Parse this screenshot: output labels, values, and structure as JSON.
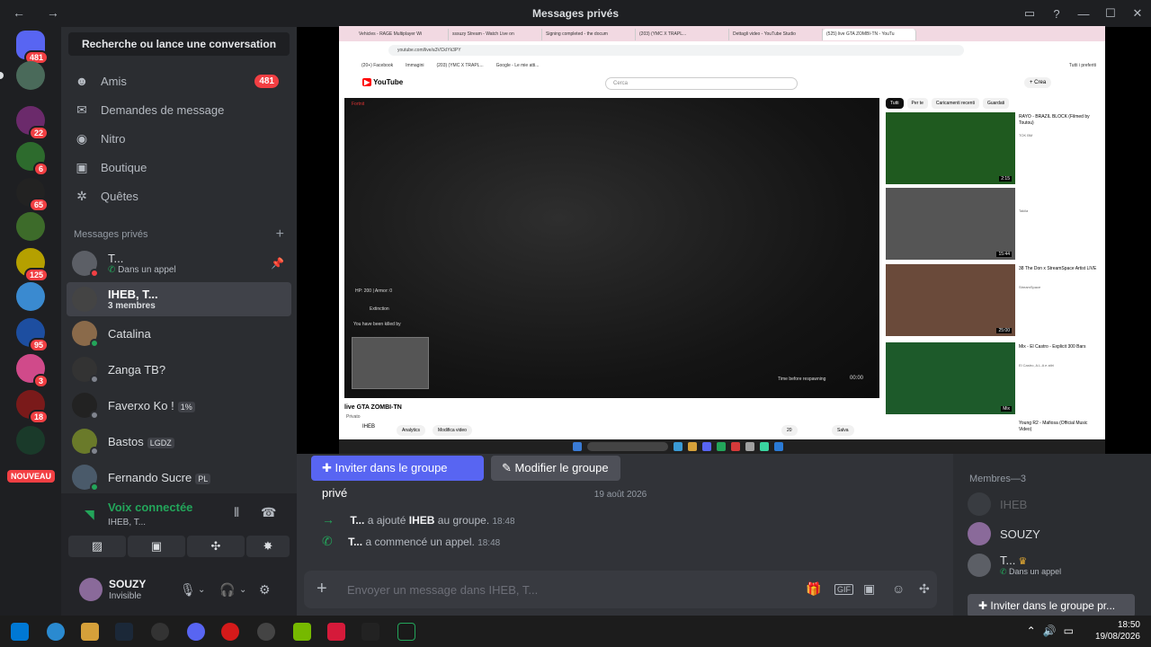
{
  "window": {
    "title": "Messages privés",
    "nav": "← →"
  },
  "guilds": {
    "badges": [
      "481",
      "",
      "22",
      "6",
      "65",
      "",
      "125",
      "",
      "95",
      "3",
      "18",
      ""
    ],
    "new_label": "NOUVEAU"
  },
  "sidebar": {
    "search_label": "Recherche ou lance une conversation",
    "nav": [
      {
        "label": "Amis",
        "icon": "friends-icon",
        "count": "481"
      },
      {
        "label": "Demandes de message",
        "icon": "mail-icon",
        "count": ""
      },
      {
        "label": "Nitro",
        "icon": "nitro-icon",
        "count": ""
      },
      {
        "label": "Boutique",
        "icon": "shop-icon",
        "count": ""
      },
      {
        "label": "Quêtes",
        "icon": "quests-icon",
        "count": ""
      }
    ],
    "dm_header": "Messages privés",
    "dms": [
      {
        "name": "T...",
        "sub": "Dans un appel",
        "tag": ""
      },
      {
        "name": "IHEB, T...",
        "sub": "3 membres",
        "tag": ""
      },
      {
        "name": "Catalina",
        "sub": "",
        "tag": ""
      },
      {
        "name": "Zanga TB?",
        "sub": "",
        "tag": ""
      },
      {
        "name": "Faverxo Ko !",
        "sub": "",
        "tag": "1%"
      },
      {
        "name": "Bastos",
        "sub": "",
        "tag": "LGDZ"
      },
      {
        "name": "Fernando Sucre",
        "sub": "",
        "tag": "PL"
      }
    ]
  },
  "voice": {
    "status": "Voix connectée",
    "channel": "IHEB, T..."
  },
  "user": {
    "name": "SOUZY",
    "status": "Invisible"
  },
  "browser": {
    "tabs": [
      "Vehicles - RAGE Multiplayer Wi",
      "sssuzy Stream - Watch Live on",
      "Signing completed - the docum",
      "(203) (YMC X TRAPL...",
      "Dettagli video - YouTube Studio",
      "(525) live GTA ZOMBI-TN - YouTu"
    ],
    "url": "youtube.com/live/a3VCkIYk3PY",
    "bookmarks": [
      "(20+) Facebook",
      "Immagini",
      "(203) (YMC X TRAPL...",
      "Google - Le mie atti...",
      "Tutti i preferiti"
    ],
    "yt_logo": "YouTube",
    "search_placeholder": "Cerca",
    "create": "+ Crea",
    "chips": [
      "Tutti",
      "Per te",
      "Caricamenti recenti",
      "Guardati"
    ],
    "video": {
      "hud_top": "Fortnit",
      "hp": "HP: 200 | Armor: 0",
      "event": "Extinction",
      "killed": "You have been killed by",
      "respawn": "Time before respawning",
      "timer": "00:00",
      "title": "live GTA ZOMBI-TN",
      "privacy": "Privato",
      "channel": "IHEB",
      "analytics": "Analytics",
      "edit": "Modifica video",
      "likes": "20",
      "save": "Salva"
    },
    "recs": [
      {
        "title": "RAYO - BRAZIL BLOCK (Filmed by Toutou)",
        "channel": "TOK BM",
        "dur": "2:15"
      },
      {
        "title": "",
        "channel": "Takila",
        "dur": "15:44"
      },
      {
        "title": "38 The Don x StreamSpace Artist LIVE",
        "channel": "StreamSpace",
        "dur": "25:00"
      },
      {
        "title": "Mix - El Castro - Explicit 300 Bars",
        "channel": "El Castro, A.L.A e altri",
        "dur": "Mix"
      },
      {
        "title": "Young R2 - Mafiosa (Official Music Video)",
        "channel": "",
        "dur": ""
      }
    ]
  },
  "chat": {
    "invite_button": "Inviter dans le groupe privé",
    "edit_button": "Modifier le groupe",
    "date": "19 août 2026",
    "messages": [
      {
        "actor": "T...",
        "action": "a ajouté",
        "target": "IHEB",
        "rest": "au groupe.",
        "time": "18:48"
      },
      {
        "actor": "T...",
        "action": "a commencé un appel.",
        "target": "",
        "rest": "",
        "time": "18:48"
      }
    ],
    "placeholder": "Envoyer un message dans IHEB, T..."
  },
  "members": {
    "header": "Membres—3",
    "list": [
      {
        "name": "IHEB",
        "sub": ""
      },
      {
        "name": "SOUZY",
        "sub": ""
      },
      {
        "name": "T...",
        "sub": "Dans un appel"
      }
    ],
    "invite": "Inviter dans le groupe pr..."
  },
  "taskbar": {
    "time": "18:50",
    "date": "19/08/2026"
  },
  "colors": {
    "blurple": "#5865f2",
    "green": "#23a55a",
    "red": "#f23f43"
  }
}
